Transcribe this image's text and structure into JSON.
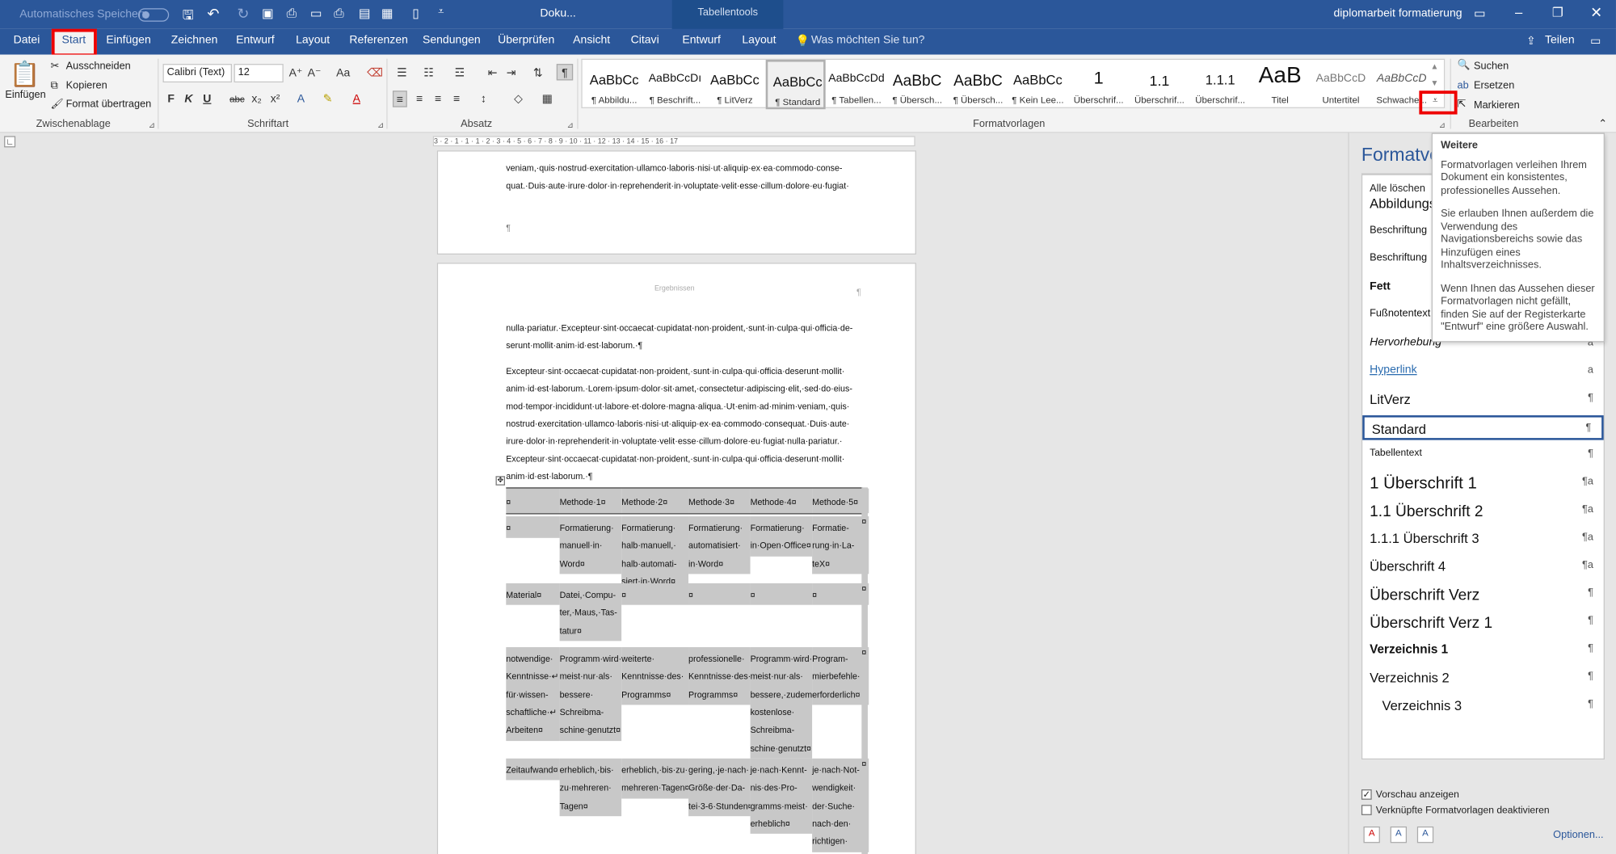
{
  "titlebar": {
    "autosave": "Automatisches Speichern",
    "doc_title": "Doku...",
    "tabletools": "Tabellentools",
    "right_title": "diplomarbeit formatierung"
  },
  "tabs": [
    "Datei",
    "Start",
    "Einfügen",
    "Zeichnen",
    "Entwurf",
    "Layout",
    "Referenzen",
    "Sendungen",
    "Überprüfen",
    "Ansicht",
    "Citavi",
    "Entwurf",
    "Layout"
  ],
  "tellme": "Was möchten Sie tun?",
  "share": "Teilen",
  "clipboard": {
    "paste": "Einfügen",
    "cut": "Ausschneiden",
    "copy": "Kopieren",
    "format": "Format übertragen",
    "label": "Zwischenablage"
  },
  "font": {
    "name": "Calibri (Text)",
    "size": "12",
    "label": "Schriftart",
    "bold": "F",
    "italic": "K",
    "underline": "U",
    "strike": "abc",
    "sub": "x₂",
    "sup": "x²",
    "case": "Aa"
  },
  "paragraph": {
    "label": "Absatz",
    "pilcrow": "¶"
  },
  "styles": {
    "label": "Formatvorlagen",
    "items": [
      {
        "preview": "AaBbCc",
        "name": "¶ Abbildu..."
      },
      {
        "preview": "AaBbCcDı",
        "name": "¶ Beschrift..."
      },
      {
        "preview": "AaBbCc",
        "name": "¶ LitVerz"
      },
      {
        "preview": "AaBbCc",
        "name": "¶ Standard"
      },
      {
        "preview": "AaBbCcDd",
        "name": "¶ Tabellen..."
      },
      {
        "preview": "AaBbC",
        "name": "¶ Übersch..."
      },
      {
        "preview": "AaBbC",
        "name": "¶ Übersch..."
      },
      {
        "preview": "AaBbCc",
        "name": "¶ Kein Lee..."
      },
      {
        "preview": "1",
        "name": "Überschrif..."
      },
      {
        "preview": "1.1",
        "name": "Überschrif..."
      },
      {
        "preview": "1.1.1",
        "name": "Überschrif..."
      },
      {
        "preview": "AaB",
        "name": "Titel"
      },
      {
        "preview": "AaBbCcD",
        "name": "Untertitel"
      },
      {
        "preview": "AaBbCcD",
        "name": "Schwache..."
      }
    ]
  },
  "editing": {
    "search": "Suchen",
    "replace": "Ersetzen",
    "select": "Markieren",
    "label": "Bearbeiten"
  },
  "ruler": "3 · 2 · 1 · 1 · 1 · 2 · 3 · 4 · 5 · 6 · 7 · 8 · 9 · 10 · 11 · 12 · 13 · 14 · 15 · 16 · 17",
  "page1": {
    "lines": [
      "veniam,·quis·nostrud·exercitation·ullamco·laboris·nisi·ut·aliquip·ex·ea·commodo·conse-",
      "quat.·Duis·aute·irure·dolor·in·reprehenderit·in·voluptate·velit·esse·cillum·dolore·eu·fugiat·"
    ],
    "pilcrow": "¶"
  },
  "page2": {
    "header": "Ergebnissen",
    "para1": [
      "nulla·pariatur.·Excepteur·sint·occaecat·cupidatat·non·proident,·sunt·in·culpa·qui·officia·de-",
      "serunt·mollit·anim·id·est·laborum.·¶"
    ],
    "para2": [
      "Excepteur·sint·occaecat·cupidatat·non·proident,·sunt·in·culpa·qui·officia·deserunt·mollit·",
      "anim·id·est·laborum.·Lorem·ipsum·dolor·sit·amet,·consectetur·adipiscing·elit,·sed·do·eius-",
      "mod·tempor·incididunt·ut·labore·et·dolore·magna·aliqua.·Ut·enim·ad·minim·veniam,·quis·",
      "nostrud·exercitation·ullamco·laboris·nisi·ut·aliquip·ex·ea·commodo·consequat.·Duis·aute·",
      "irure·dolor·in·reprehenderit·in·voluptate·velit·esse·cillum·dolore·eu·fugiat·nulla·pariatur.·",
      "Excepteur·sint·occaecat·cupidatat·non·proident,·sunt·in·culpa·qui·officia·deserunt·mollit·",
      "anim·id·est·laborum.·¶"
    ]
  },
  "table": {
    "header": [
      "¤",
      "Methode·1¤",
      "Methode·2¤",
      "Methode·3¤",
      "Methode·4¤",
      "Methode·5¤"
    ],
    "rows": [
      [
        [
          "¤"
        ],
        [
          "Formatierung·",
          "manuell·in·",
          "Word¤"
        ],
        [
          "Formatierung·",
          "halb·manuell,·",
          "halb·automati-",
          "siert·in·Word¤"
        ],
        [
          "Formatierung·",
          "automatisiert·",
          "in·Word¤"
        ],
        [
          "Formatierung·",
          "in·Open·Office¤"
        ],
        [
          "Formatie-",
          "rung·in·La-",
          "teX¤"
        ]
      ],
      [
        [
          "Material¤"
        ],
        [
          "Datei,·Compu-",
          "ter,·Maus,·Tas-",
          "tatur¤"
        ],
        [
          "¤"
        ],
        [
          "¤"
        ],
        [
          "¤"
        ],
        [
          "¤"
        ]
      ],
      [
        [
          "notwendige·",
          "Kenntnisse·↵",
          "für·wissen-",
          "schaftliche·↵",
          "Arbeiten¤"
        ],
        [
          "Programm·wird·",
          "meist·nur·als·",
          "bessere·",
          "Schreibma-",
          "schine·genutzt¤"
        ],
        [
          "weiterte·",
          "Kenntnisse·des·",
          "Programms¤"
        ],
        [
          "professionelle·",
          "Kenntnisse·des·",
          "Programms¤"
        ],
        [
          "Programm·wird·",
          "meist·nur·als·",
          "bessere,·zudem·",
          "kostenlose·",
          "Schreibma-",
          "schine·genutzt¤"
        ],
        [
          "Program-",
          "mierbefehle·",
          "erforderlich¤"
        ]
      ],
      [
        [
          "Zeitaufwand¤"
        ],
        [
          "erheblich,·bis·",
          "zu·mehreren·",
          "Tagen¤"
        ],
        [
          "erheblich,·bis·zu·",
          "mehreren·Tagen¤"
        ],
        [
          "gering,·je·nach·",
          "Größe·der·Da-",
          "tei·3-6·Stunden¤"
        ],
        [
          "je·nach·Kennt-",
          "nis·des·Pro-",
          "gramms·meist·",
          "erheblich¤"
        ],
        [
          "je·nach·Not-",
          "wendigkeit·",
          "der·Suche·",
          "nach·den·",
          "richtigen·"
        ]
      ]
    ]
  },
  "stylepane": {
    "title": "Formatvo",
    "clear": "Alle löschen",
    "items": [
      {
        "name": "Abbildungs",
        "mark": ""
      },
      {
        "name": "Beschriftung",
        "mark": ""
      },
      {
        "name": "Beschriftung",
        "mark": ""
      },
      {
        "name": "Fett",
        "mark": ""
      },
      {
        "name": "Fußnotentext",
        "mark": "¶a"
      },
      {
        "name": "Hervorhebung",
        "mark": "a"
      },
      {
        "name": "Hyperlink",
        "mark": "a"
      },
      {
        "name": "LitVerz",
        "mark": "¶"
      },
      {
        "name": "Standard",
        "mark": "¶"
      },
      {
        "name": "Tabellentext",
        "mark": "¶"
      },
      {
        "name": "1  Überschrift 1",
        "mark": "¶a"
      },
      {
        "name": "1.1  Überschrift 2",
        "mark": "¶a"
      },
      {
        "name": "1.1.1  Überschrift 3",
        "mark": "¶a"
      },
      {
        "name": "Überschrift 4",
        "mark": "¶a"
      },
      {
        "name": "Überschrift Verz",
        "mark": "¶"
      },
      {
        "name": "Überschrift Verz 1",
        "mark": "¶"
      },
      {
        "name": "Verzeichnis 1",
        "mark": "¶"
      },
      {
        "name": "Verzeichnis 2",
        "mark": "¶"
      },
      {
        "name": "Verzeichnis 3",
        "mark": "¶"
      }
    ],
    "preview": "Vorschau anzeigen",
    "linked": "Verknüpfte Formatvorlagen deaktivieren",
    "options": "Optionen..."
  },
  "tooltip": {
    "title": "Weitere",
    "p1": "Formatvorlagen verleihen Ihrem Dokument ein konsistentes, professionelles Aussehen.",
    "p2": "Sie erlauben Ihnen außerdem die Verwendung des Navigationsbereichs sowie das Hinzufügen eines Inhaltsverzeichnisses.",
    "p3": "Wenn Ihnen das Aussehen dieser Formatvorlagen nicht gefällt, finden Sie auf der Registerkarte \"Entwurf\" eine größere Auswahl."
  },
  "colors": {
    "brand": "#2b579a",
    "highlight": "#e00000",
    "tableshade": "#c8c8c8"
  }
}
